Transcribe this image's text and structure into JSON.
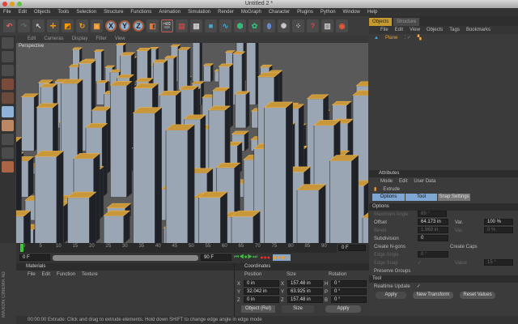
{
  "window": {
    "title": "Untitled 2 *"
  },
  "menu": [
    "File",
    "Edit",
    "Objects",
    "Tools",
    "Selection",
    "Structure",
    "Functions",
    "Animation",
    "Simulation",
    "Render",
    "MoGraph",
    "Character",
    "Plugins",
    "Python",
    "Window",
    "Help"
  ],
  "toolbar": {
    "axes": [
      "X",
      "Y",
      "Z"
    ]
  },
  "viewport": {
    "menu": [
      "Edit",
      "Cameras",
      "Display",
      "Filter",
      "View"
    ],
    "label": "Perspective"
  },
  "objects": {
    "tabs": [
      "Objects",
      "Structure"
    ],
    "menu": [
      "File",
      "Edit",
      "View",
      "Objects",
      "Tags",
      "Bookmarks"
    ],
    "items": [
      {
        "name": "Plane"
      }
    ]
  },
  "attributes": {
    "title": "Attributes",
    "menu": [
      "Mode",
      "Edit",
      "User Data"
    ],
    "tool_name": "Extrude",
    "tabs": [
      "Options",
      "Tool",
      "Snap Settings"
    ],
    "options_header": "Options",
    "fields": {
      "max_angle_label": "Maximum Angle",
      "max_angle": "89 °",
      "offset_label": "Offset",
      "offset": "64.173 in",
      "var_label": "Var.",
      "var": "100 %",
      "bevel_label": "Bevel",
      "bevel": "1.969 in",
      "var2_label": "Var.",
      "var2": "0 %",
      "subdivision_label": "Subdivision",
      "subdivision": "0",
      "create_ngons": "Create N-gons",
      "create_caps": "Create Caps",
      "edge_angle_label": "Edge Angle",
      "edge_angle": "0 °",
      "edge_snap": "Edge Snap",
      "value_label": "Value",
      "value": "15 °",
      "preserve_groups": "Preserve Groups"
    },
    "tool_header": "Tool",
    "realtime_update": "Realtime Update",
    "buttons": [
      "Apply",
      "New Transform",
      "Reset Values"
    ]
  },
  "timeline": {
    "ticks": [
      "0",
      "5",
      "10",
      "15",
      "20",
      "25",
      "30",
      "35",
      "40",
      "45",
      "50",
      "55",
      "60",
      "65",
      "70",
      "75",
      "80",
      "85",
      "90"
    ],
    "current": "0 F",
    "start": "0 F",
    "range_end": "90 F",
    "end": "90 F",
    "playhead": 0
  },
  "materials": {
    "title": "Materials",
    "menu": [
      "File",
      "Edit",
      "Function",
      "Texture"
    ]
  },
  "coordinates": {
    "title": "Coordinates",
    "headers": [
      "Position",
      "Size",
      "Rotation"
    ],
    "rows": [
      {
        "a": "X",
        "pos": "0 in",
        "s": "X",
        "size": "157.48 in",
        "r": "H",
        "rot": "0 °"
      },
      {
        "a": "Y",
        "pos": "32.042 in",
        "s": "Y",
        "size": "63.925 in",
        "r": "P",
        "rot": "0 °"
      },
      {
        "a": "Z",
        "pos": "0 in",
        "s": "Z",
        "size": "157.48 in",
        "r": "B",
        "rot": "0 °"
      }
    ],
    "mode": "Object (Rel)",
    "size_mode": "Size",
    "apply": "Apply"
  },
  "status": {
    "text": "00:00:00  Extrude: Click and drag to extrude elements. Hold down SHIFT to change edge angle in edge mode"
  },
  "brand": "MAXON CINEMA 4D"
}
